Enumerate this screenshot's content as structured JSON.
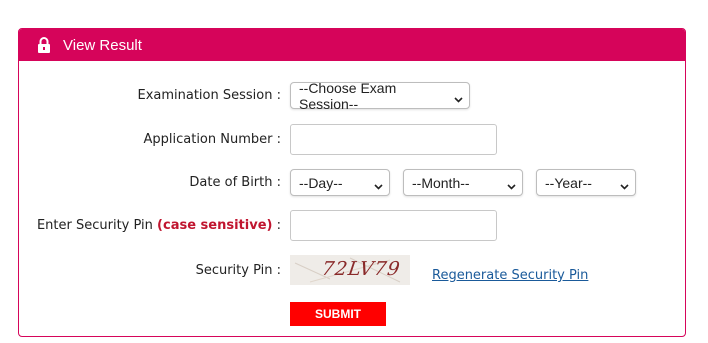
{
  "header": {
    "title": "View Result",
    "color": "#d6045a"
  },
  "form": {
    "exam_session": {
      "label": "Examination Session :",
      "selected": "--Choose Exam Session--"
    },
    "application_number": {
      "label": "Application Number :",
      "value": ""
    },
    "dob": {
      "label": "Date of Birth :",
      "day": "--Day--",
      "month": "--Month--",
      "year": "--Year--"
    },
    "security_pin_input": {
      "label_main": "Enter Security Pin",
      "label_hint": "(case sensitive)",
      "label_suffix": ":",
      "value": ""
    },
    "security_pin": {
      "label": "Security Pin :",
      "captcha_text": "72LV79",
      "regenerate_label": "Regenerate Security Pin"
    },
    "submit_label": "SUBMIT"
  }
}
